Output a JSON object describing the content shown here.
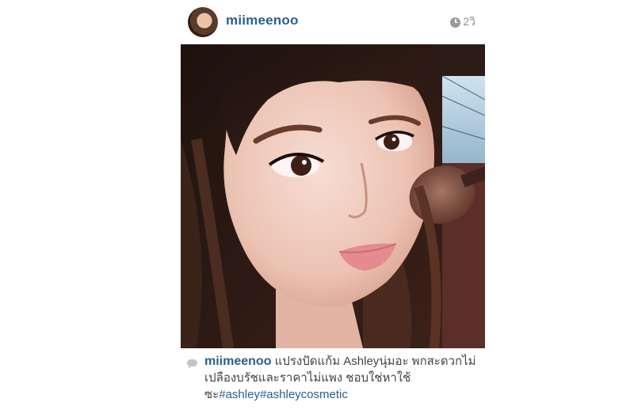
{
  "post": {
    "username": "miimeenoo",
    "time": "2วิ"
  },
  "photo": {
    "description": ""
  },
  "caption": {
    "username": "miimeenoo",
    "text": "แปรงปัดแก้ม Ashleyนุ่มอะ พกสะดวกไม่เปลืองบรัชและราคาไม่แพง ชอบใช่หาใช้ซะ",
    "hashtags": [
      "#ashley",
      "#ashleycosmetic"
    ]
  },
  "colors": {
    "link": "#2c5f8a",
    "muted": "#8e8e8e"
  },
  "icons": {
    "timestamp": "clock-icon",
    "caption": "comment-icon"
  }
}
